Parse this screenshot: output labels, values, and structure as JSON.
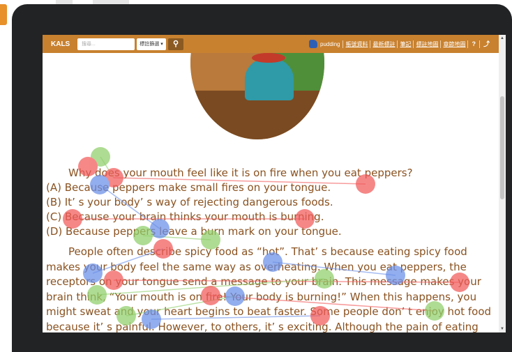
{
  "app": {
    "brand": "KALS"
  },
  "search": {
    "placeholder": "搜尋...",
    "filter_label": "標註篩選 ▾",
    "button_icon": "search-icon"
  },
  "user": {
    "name": "pudding",
    "avatar_icon": "user-avatar-icon"
  },
  "nav": {
    "links": [
      "帳號資料",
      "最新標註",
      "筆記",
      "標註地圖",
      "章節地圖"
    ],
    "help_icon": "help-icon",
    "share_icon": "share-icon"
  },
  "article": {
    "question": "Why does your mouth feel like it is on fire when you eat peppers?",
    "options": [
      "(A) Because peppers make small fires on your tongue.",
      "(B) It’ s your body’ s way of rejecting dangerous foods.",
      "(C) Because your brain thinks your mouth is burning.",
      "(D) Because peppers leave a burn mark on your tongue."
    ],
    "paragraph": "People often describe spicy food as “hot”. That’ s because eating spicy food makes your body feel the same way as overheating. When you eat peppers, the receptors on your tongue send a message to your brain. This message makes your brain think, “Your mouth is on fire! Your body is burning!” When this happens, you might sweat and your heart begins to beat faster. Some people don’ t enjoy hot food because it’ s painful. However, to others, it’ s exciting. Although the pain of eating"
  },
  "colors": {
    "navbar": "#c8812f",
    "text": "#8a5220",
    "gaze_red": "#f25a5a",
    "gaze_blue": "#6a8fe8",
    "gaze_green": "#8fcf6a"
  }
}
